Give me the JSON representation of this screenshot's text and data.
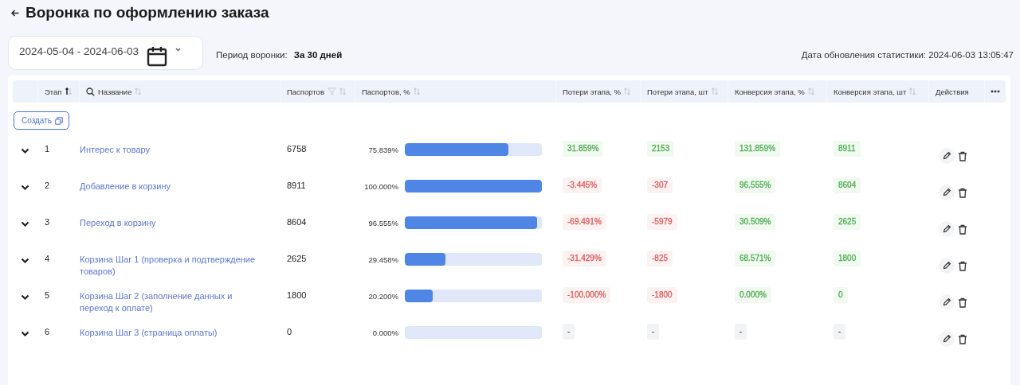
{
  "title": "Воронка по оформлению заказа",
  "date_range": {
    "value": "2024-05-04 - 2024-06-03"
  },
  "period": {
    "label": "Период воронки:",
    "value": "За 30 дней"
  },
  "updated": "Дата обновления статистики: 2024-06-03 13:05:47",
  "table": {
    "columns": [
      {
        "label": "Этап",
        "sortable": true,
        "sorted": true
      },
      {
        "label": "Название",
        "search": true,
        "sortable": true,
        "sorted": false
      },
      {
        "label": "Паспортов",
        "filter": true,
        "sortable": true,
        "sorted": false
      },
      {
        "label": "Паспортов, %",
        "sortable": true,
        "sorted": false
      },
      {
        "label": "Потери этапа, %",
        "sortable": true,
        "sorted": false
      },
      {
        "label": "Потери этапа, шт",
        "sortable": true,
        "sorted": false
      },
      {
        "label": "Конверсия этапа, %",
        "sortable": true,
        "sorted": false
      },
      {
        "label": "Конверсия этапа, шт",
        "sortable": true,
        "sorted": false
      },
      {
        "label": "Действия"
      }
    ],
    "create_button": "Создать",
    "rows": [
      {
        "stage": "1",
        "name": "Интерес к товару",
        "passports": "6758",
        "share": "75.839%",
        "level": 0.75839,
        "metrics": [
          {
            "text": "31.859%",
            "color": "#4caf50"
          },
          {
            "text": "2153",
            "color": "#4caf50"
          },
          {
            "text": "131.859%",
            "color": "#4caf50"
          },
          {
            "text": "8911",
            "color": "#4caf50"
          }
        ]
      },
      {
        "stage": "2",
        "name": "Добавление в корзину",
        "passports": "8911",
        "share": "100.000%",
        "level": 1,
        "metrics": [
          {
            "text": "-3.445%",
            "color": "#e05a5a"
          },
          {
            "text": "-307",
            "color": "#e05a5a"
          },
          {
            "text": "96.555%",
            "color": "#4caf50"
          },
          {
            "text": "8604",
            "color": "#4caf50"
          }
        ]
      },
      {
        "stage": "3",
        "name": "Переход в корзину",
        "passports": "8604",
        "share": "96.555%",
        "level": 0.96555,
        "metrics": [
          {
            "text": "-69.491%",
            "color": "#e05a5a"
          },
          {
            "text": "-5979",
            "color": "#e05a5a"
          },
          {
            "text": "30.509%",
            "color": "#4caf50"
          },
          {
            "text": "2625",
            "color": "#4caf50"
          }
        ]
      },
      {
        "stage": "4",
        "name": "Корзина Шаг 1 (проверка и подтверждение товаров)",
        "passports": "2625",
        "share": "29.458%",
        "level": 0.29458,
        "metrics": [
          {
            "text": "-31.429%",
            "color": "#e05a5a"
          },
          {
            "text": "-825",
            "color": "#e05a5a"
          },
          {
            "text": "68.571%",
            "color": "#4caf50"
          },
          {
            "text": "1800",
            "color": "#4caf50"
          }
        ]
      },
      {
        "stage": "5",
        "name": "Корзина Шаг 2 (заполнение данных и переход к оплате)",
        "passports": "1800",
        "share": "20.200%",
        "level": 0.202,
        "metrics": [
          {
            "text": "-100.000%",
            "color": "#e05a5a"
          },
          {
            "text": "-1800",
            "color": "#e05a5a"
          },
          {
            "text": "0.000%",
            "color": "#4caf50"
          },
          {
            "text": "0",
            "color": "#4caf50"
          }
        ]
      },
      {
        "stage": "6",
        "name": "Корзина Шаг 3 (страница оплаты)",
        "passports": "0",
        "share": "0.000%",
        "level": 0,
        "metrics": [
          {
            "text": "-"
          },
          {
            "text": "-"
          },
          {
            "text": "-"
          },
          {
            "text": "-"
          }
        ]
      }
    ]
  }
}
